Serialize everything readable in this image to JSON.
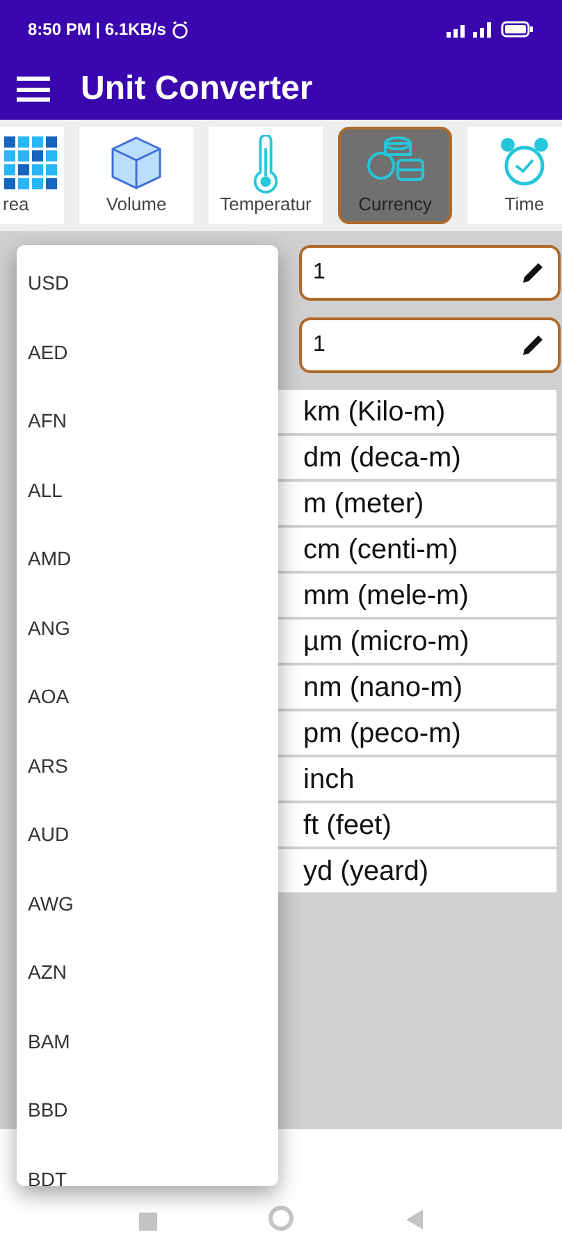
{
  "status_bar": {
    "time": "8:50 PM | 6.1KB/s"
  },
  "app_bar": {
    "title": "Unit Converter"
  },
  "categories": [
    {
      "label": "rea",
      "kind": "area",
      "selected": false
    },
    {
      "label": "Volume",
      "kind": "volume",
      "selected": false
    },
    {
      "label": "Temperatur",
      "kind": "temperature",
      "selected": false
    },
    {
      "label": "Currency",
      "kind": "currency",
      "selected": true
    },
    {
      "label": "Time",
      "kind": "time",
      "selected": false
    }
  ],
  "inputs": [
    {
      "value": "1"
    },
    {
      "value": "1"
    }
  ],
  "units": [
    "km (Kilo-m)",
    "dm (deca-m)",
    "m (meter)",
    "cm (centi-m)",
    "mm (mele-m)",
    "µm (micro-m)",
    "nm (nano-m)",
    "pm (peco-m)",
    "inch",
    "ft (feet)",
    "yd (yeard)"
  ],
  "dropdown": {
    "options": [
      "USD",
      "AED",
      "AFN",
      "ALL",
      "AMD",
      "ANG",
      "AOA",
      "ARS",
      "AUD",
      "AWG",
      "AZN",
      "BAM",
      "BBD",
      "BDT"
    ]
  }
}
